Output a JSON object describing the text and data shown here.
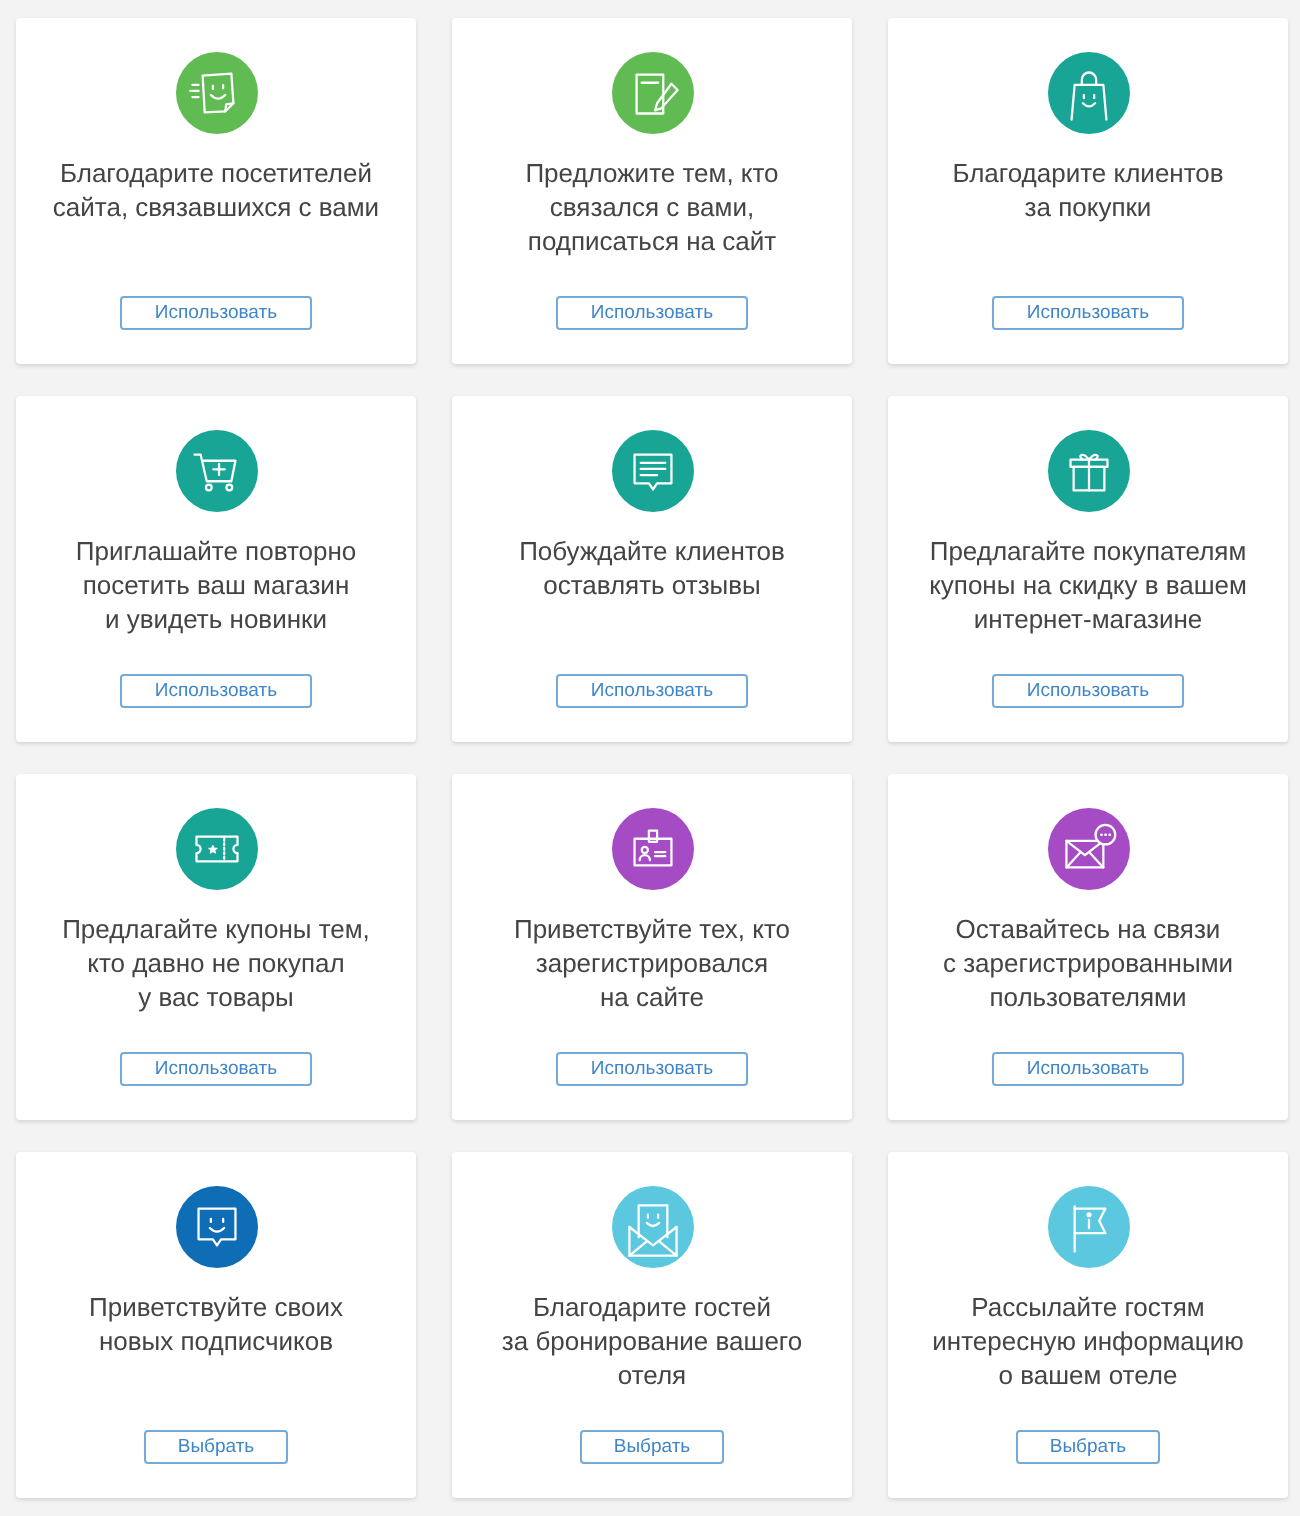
{
  "cards": [
    {
      "color": "#5fbb52",
      "text": "Благодарите посетителей\nсайта, связавшихся с вами",
      "button": "Использовать"
    },
    {
      "color": "#5fbb52",
      "text": "Предложите тем, кто\nсвязался с вами,\nподписаться на сайт",
      "button": "Использовать"
    },
    {
      "color": "#19a596",
      "text": "Благодарите клиентов\nза покупки",
      "button": "Использовать"
    },
    {
      "color": "#19a596",
      "text": "Приглашайте повторно\nпосетить ваш магазин\nи увидеть новинки",
      "button": "Использовать"
    },
    {
      "color": "#19a596",
      "text": "Побуждайте клиентов\nоставлять отзывы",
      "button": "Использовать"
    },
    {
      "color": "#19a596",
      "text": "Предлагайте покупателям\nкупоны на скидку в вашем\nинтернет-магазине",
      "button": "Использовать"
    },
    {
      "color": "#19a596",
      "text": "Предлагайте купоны тем,\nкто давно не покупал\nу вас товары",
      "button": "Использовать"
    },
    {
      "color": "#a54bc4",
      "text": "Приветствуйте тех, кто\nзарегистрировался\nна сайте",
      "button": "Использовать"
    },
    {
      "color": "#a54bc4",
      "text": "Оставайтесь на связи\nс зарегистрированными\nпользователями",
      "button": "Использовать"
    },
    {
      "color": "#0f6db5",
      "text": "Приветствуйте своих\nновых подписчиков",
      "button": "Выбрать"
    },
    {
      "color": "#5bc8e0",
      "text": "Благодарите гостей\nза бронирование вашего\nотеля",
      "button": "Выбрать"
    },
    {
      "color": "#5bc8e0",
      "text": "Рассылайте гостям\nинтересную информацию\nо вашем отеле",
      "button": "Выбрать"
    }
  ]
}
